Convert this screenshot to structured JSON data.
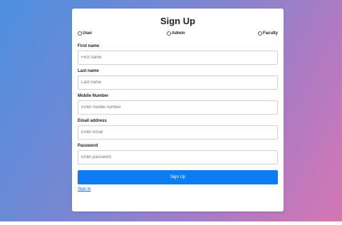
{
  "colors": {
    "background_start": "#4d8fe0",
    "background_end": "#d677b3",
    "primary_button": "#0d7cf2",
    "link": "#0d6efd"
  },
  "form": {
    "title": "Sign Up",
    "roles": [
      {
        "label": "User",
        "selected": false
      },
      {
        "label": "Admin",
        "selected": false
      },
      {
        "label": "Faculty",
        "selected": false
      }
    ],
    "fields": [
      {
        "label": "First name",
        "placeholder": "First name",
        "value": ""
      },
      {
        "label": "Last name",
        "placeholder": "Last name",
        "value": ""
      },
      {
        "label": "Mobile Number",
        "placeholder": "Enter mobile number",
        "value": ""
      },
      {
        "label": "Email address",
        "placeholder": "Enter email",
        "value": ""
      },
      {
        "label": "Password",
        "placeholder": "Enter password",
        "value": ""
      }
    ],
    "submit_label": "Sign Up",
    "signin_link": "Sign in"
  }
}
